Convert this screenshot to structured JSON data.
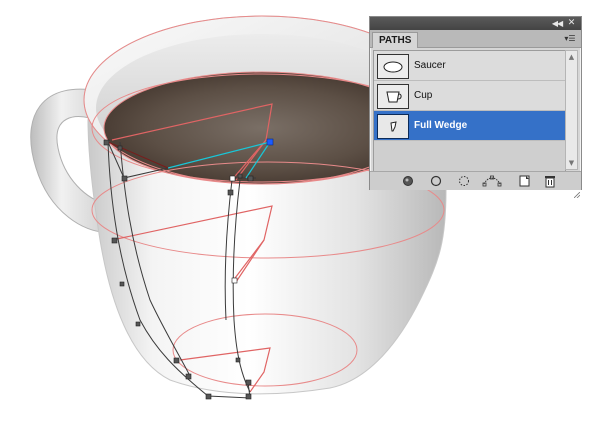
{
  "panel": {
    "title": "PATHS",
    "collapse_icon": "double-chevron-icon",
    "close_icon": "close-icon",
    "menu_icon": "panel-menu-icon",
    "items": [
      {
        "label": "Saucer",
        "icon": "saucer-thumb",
        "selected": false
      },
      {
        "label": "Cup",
        "icon": "cup-thumb",
        "selected": false
      },
      {
        "label": "Full Wedge",
        "icon": "wedge-thumb",
        "selected": true
      }
    ],
    "footer_buttons": [
      {
        "name": "fill-path-button",
        "icon": "fill-circle-icon"
      },
      {
        "name": "stroke-path-button",
        "icon": "stroke-circle-icon"
      },
      {
        "name": "load-selection-button",
        "icon": "dashed-circle-icon"
      },
      {
        "name": "make-work-path-button",
        "icon": "work-path-icon"
      },
      {
        "name": "new-path-button",
        "icon": "new-page-icon"
      },
      {
        "name": "delete-path-button",
        "icon": "trash-icon"
      }
    ]
  },
  "colors": {
    "selection_blue": "#3571c8",
    "guide_red": "#e07a7a",
    "path_dark": "#333333",
    "active_segment_cyan": "#18c7d8",
    "anchor_blue": "#1b5bff",
    "coffee_dark": "#4a3d34"
  }
}
